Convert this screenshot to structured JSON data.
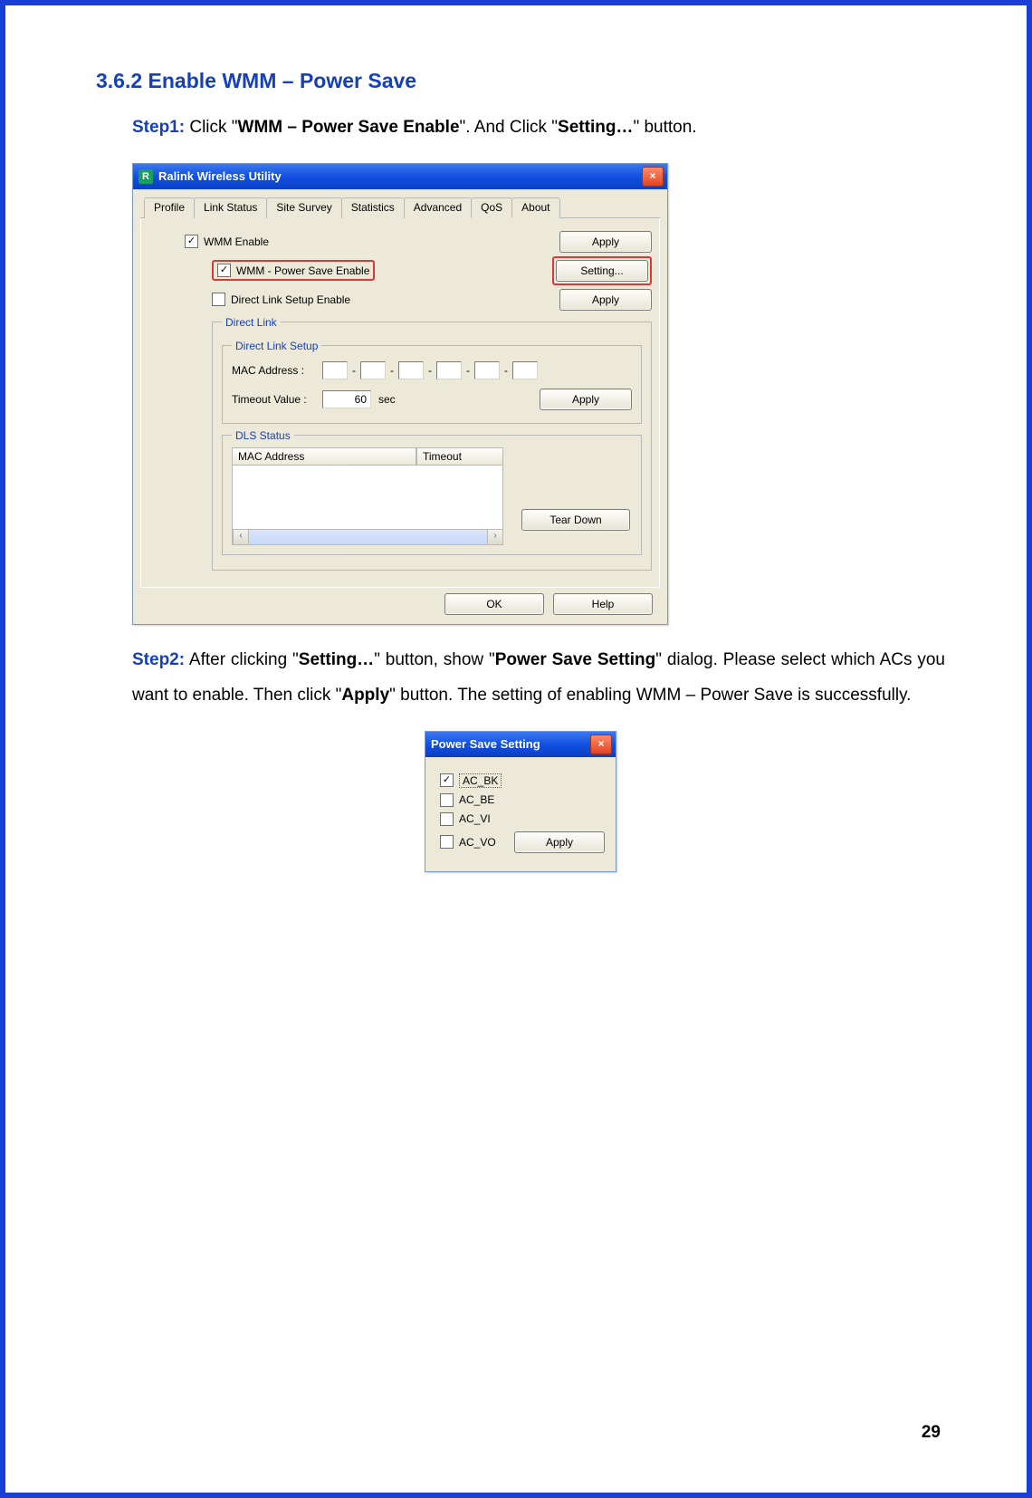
{
  "section": {
    "number": "3.6.2",
    "title": "Enable WMM – Power Save"
  },
  "step1": {
    "label": "Step1:",
    "t1": " Click \"",
    "b1": "WMM – Power Save Enable",
    "t2": "\". And Click \"",
    "b2": "Setting…",
    "t3": "\" button."
  },
  "step2": {
    "label": "Step2:",
    "t1": " After clicking \"",
    "b1": "Setting…",
    "t2": "\" button, show \"",
    "b2": "Power Save Setting",
    "t3": "\" dialog. Please select which ACs you want to enable. Then click \"",
    "b3": "Apply",
    "t4": "\" button. The setting of enabling WMM – Power Save is successfully."
  },
  "dlg1": {
    "title": "Ralink Wireless Utility",
    "tabs": [
      "Profile",
      "Link Status",
      "Site Survey",
      "Statistics",
      "Advanced",
      "QoS",
      "About"
    ],
    "activeTab": 5,
    "wmm_enable": "WMM Enable",
    "wmm_ps": "WMM - Power Save Enable",
    "dls_enable": "Direct Link Setup Enable",
    "apply": "Apply",
    "setting": "Setting...",
    "fs_direct_link": "Direct Link",
    "fs_dls_setup": "Direct Link Setup",
    "mac_label": "MAC Address :",
    "timeout_label": "Timeout Value :",
    "timeout_value": "60",
    "timeout_unit": "sec",
    "fs_dls_status": "DLS Status",
    "col_mac": "MAC Address",
    "col_timeout": "Timeout",
    "tear_down": "Tear Down",
    "ok": "OK",
    "help": "Help"
  },
  "dlg2": {
    "title": "Power Save Setting",
    "options": [
      "AC_BK",
      "AC_BE",
      "AC_VI",
      "AC_VO"
    ],
    "checked": [
      true,
      false,
      false,
      false
    ],
    "apply": "Apply"
  },
  "page_number": "29"
}
